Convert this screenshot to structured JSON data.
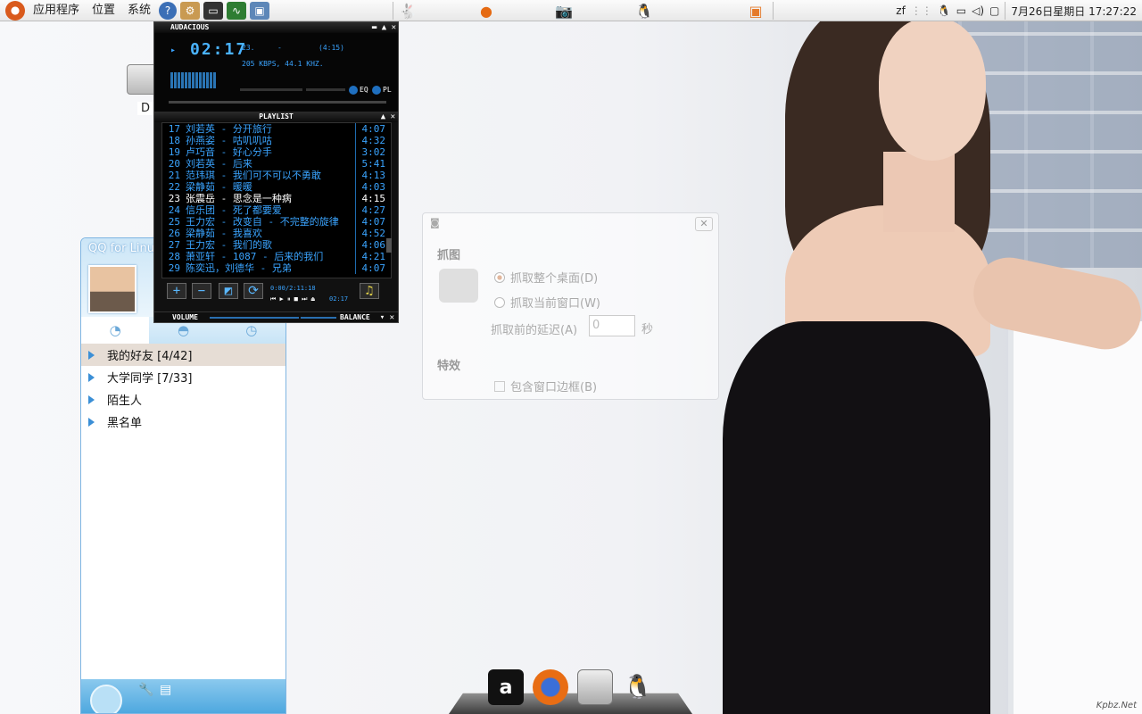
{
  "top_panel": {
    "menus": [
      "应用程序",
      "位置",
      "系统"
    ],
    "user": "zf",
    "clock": "7月26日星期日 17:27:22"
  },
  "desktop": {
    "drive_label": "D"
  },
  "audacious": {
    "title": "AUDACIOUS",
    "time": "02:17",
    "track_no": "23.",
    "track_sep": "-",
    "track_len": "(4:15)",
    "bitrate": "205 KBPS, 44.1 KHZ.",
    "eq_label": "EQ",
    "pl_label": "PL",
    "playlist_title": "PLAYLIST",
    "playlist": [
      {
        "num": "17",
        "title": "刘若英 - 分开旅行",
        "dur": "4:07"
      },
      {
        "num": "18",
        "title": "孙燕姿 - 咕叽叽咕",
        "dur": "4:32"
      },
      {
        "num": "19",
        "title": "卢巧音 - 好心分手",
        "dur": "3:02"
      },
      {
        "num": "20",
        "title": "刘若英 - 后来",
        "dur": "5:41"
      },
      {
        "num": "21",
        "title": "范玮琪 - 我们可不可以不勇敢",
        "dur": "4:13"
      },
      {
        "num": "22",
        "title": "梁静茹 - 暖暖",
        "dur": "4:03"
      },
      {
        "num": "23",
        "title": "张震岳 - 思念是一种病",
        "dur": "4:15"
      },
      {
        "num": "24",
        "title": "信乐团 - 死了都要爱",
        "dur": "4:27"
      },
      {
        "num": "25",
        "title": "王力宏 - 改变自 - 不完整的旋律",
        "dur": "4:07"
      },
      {
        "num": "26",
        "title": "梁静茹 - 我喜欢",
        "dur": "4:52"
      },
      {
        "num": "27",
        "title": "王力宏 - 我们的歌",
        "dur": "4:06"
      },
      {
        "num": "28",
        "title": "萧亚轩 - 1087 - 后来的我们",
        "dur": "4:21"
      },
      {
        "num": "29",
        "title": "陈奕迅，刘德华 - 兄弟",
        "dur": "4:07"
      }
    ],
    "current_index": 6,
    "pl_time": "0:00/2:11:18",
    "pl_pos": "02:17",
    "volume_label": "VOLUME",
    "balance_label": "BALANCE"
  },
  "qq": {
    "title": "QQ for Linux",
    "groups": [
      {
        "label": "我的好友 [4/42]",
        "selected": true
      },
      {
        "label": "大学同学 [7/33]",
        "selected": false
      },
      {
        "label": "陌生人",
        "selected": false
      },
      {
        "label": "黑名单",
        "selected": false
      }
    ]
  },
  "screenshot_dialog": {
    "section_grab": "抓图",
    "opt_desktop": "抓取整个桌面(D)",
    "opt_window": "抓取当前窗口(W)",
    "delay_label": "抓取前的延迟(A)",
    "delay_value": "0",
    "delay_unit": "秒",
    "section_effects": "特效",
    "opt_border": "包含窗口边框(B)"
  },
  "watermark": "Kpbz.Net",
  "colors": {
    "lcd_blue": "#3aa4ff",
    "qq_blue": "#4ea8df",
    "ubuntu_orange": "#d95a1c"
  }
}
